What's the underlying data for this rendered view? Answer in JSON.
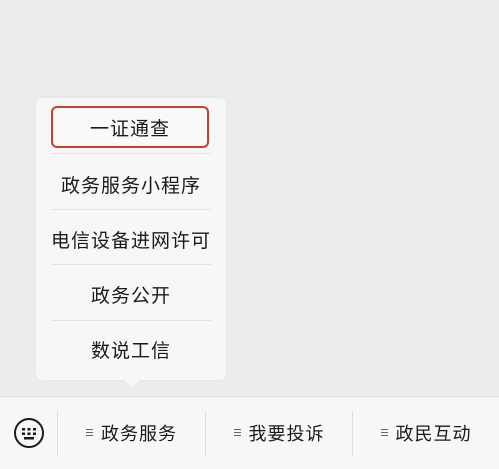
{
  "popup": {
    "items": [
      {
        "label": "一证通查"
      },
      {
        "label": "政务服务小程序"
      },
      {
        "label": "电信设备进网许可"
      },
      {
        "label": "政务公开"
      },
      {
        "label": "数说工信"
      }
    ]
  },
  "tabbar": {
    "keyboard_icon": "keyboard-icon",
    "tabs": [
      {
        "label": "政务服务",
        "icon": "menu-lines-icon"
      },
      {
        "label": "我要投诉",
        "icon": "menu-lines-icon"
      },
      {
        "label": "政民互动",
        "icon": "menu-lines-icon"
      }
    ]
  },
  "colors": {
    "highlight_border": "#c9412b",
    "background": "#ededed"
  }
}
